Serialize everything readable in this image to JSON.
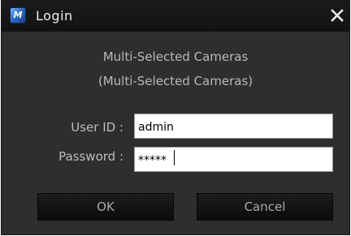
{
  "window": {
    "title": "Login",
    "app_icon_name": "app-logo-icon",
    "close_icon_name": "close-icon"
  },
  "cameras": {
    "line1": "Multi-Selected Cameras",
    "line2": "(Multi-Selected Cameras)"
  },
  "form": {
    "user_id_label": "User ID :",
    "user_id_value": "admin",
    "password_label": "Password :",
    "password_value": "*****"
  },
  "buttons": {
    "ok_label": "OK",
    "cancel_label": "Cancel"
  },
  "colors": {
    "dialog_background": "#2e2e2e",
    "titlebar_background": "#141414",
    "label_text": "#bdbdbd",
    "button_background": "#151515"
  }
}
